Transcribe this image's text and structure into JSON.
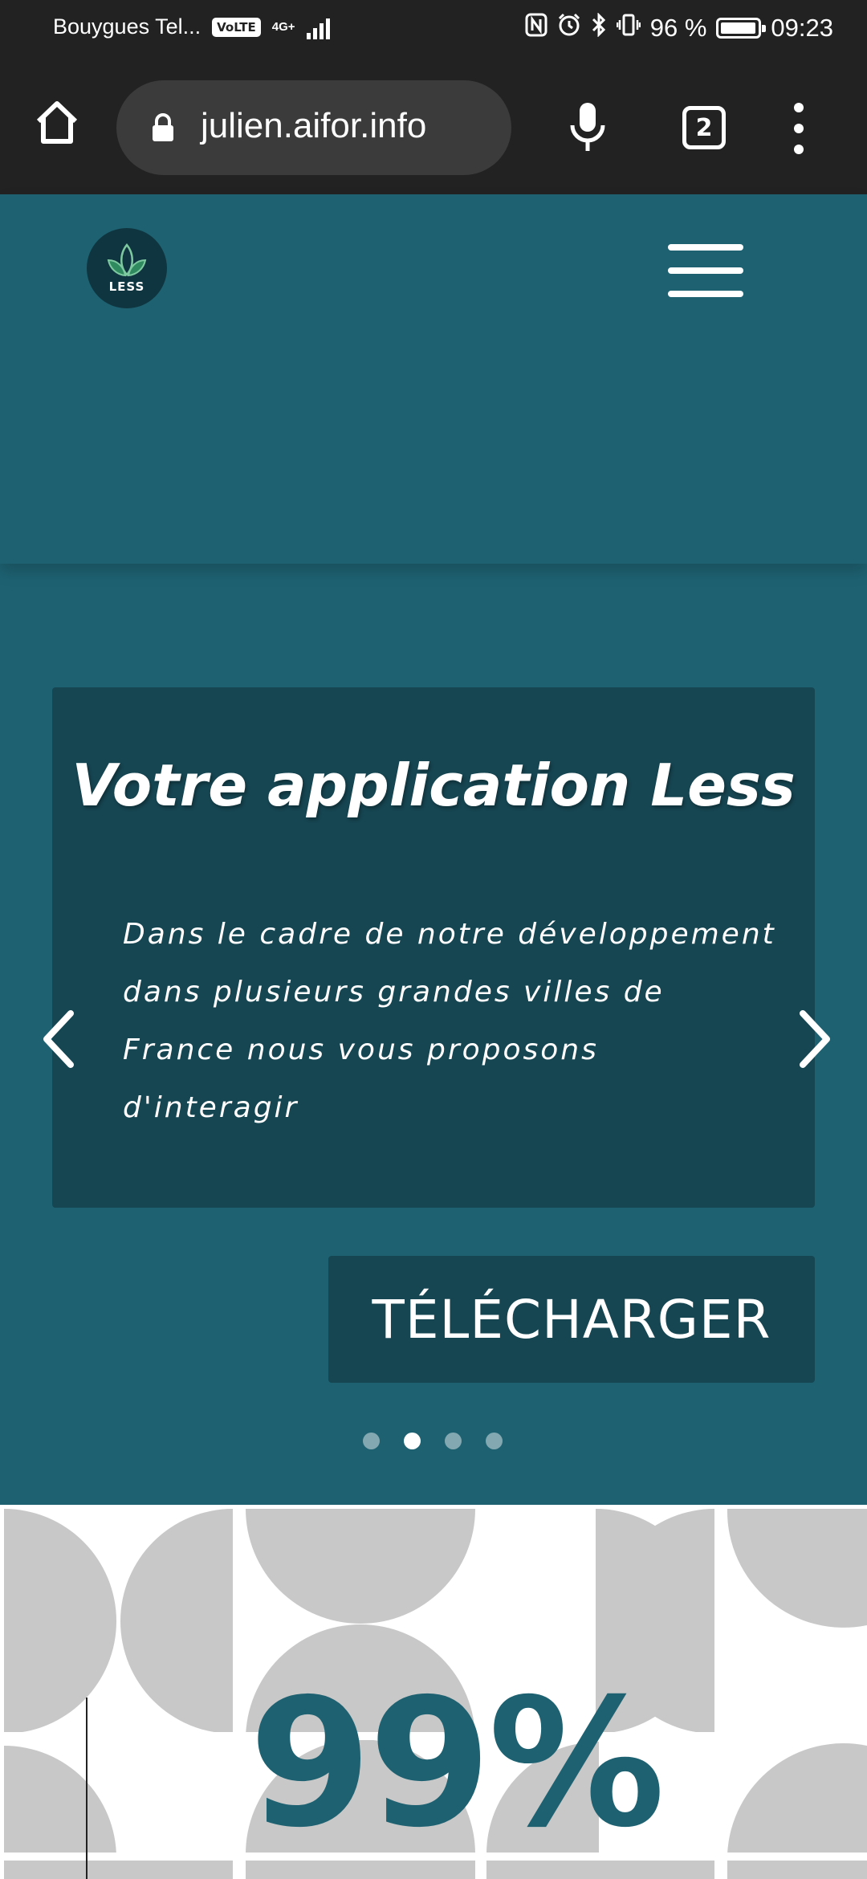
{
  "status_bar": {
    "carrier": "Bouygues Tel...",
    "volte": "VoLTE",
    "network": "4G+",
    "battery": "96 %",
    "time": "09:23",
    "icons": [
      "nfc-icon",
      "alarm-icon",
      "bluetooth-icon",
      "vibrate-icon",
      "battery-icon"
    ]
  },
  "browser": {
    "url": "julien.aifor.info",
    "tab_count": "2"
  },
  "header": {
    "logo_text": "LESS"
  },
  "hero": {
    "title": "Votre application Less",
    "body": "Dans le cadre de notre développement dans plusieurs grandes villes de France nous vous proposons d'interagir",
    "download_label": "TÉLÉCHARGER",
    "carousel": {
      "slide_count": 4,
      "active_index": 1
    }
  },
  "stats": {
    "value": "99%"
  },
  "colors": {
    "primary": "#1e6272",
    "card": "#164652",
    "browser_chrome": "#222222",
    "pattern_gray": "#c8c8c8"
  }
}
